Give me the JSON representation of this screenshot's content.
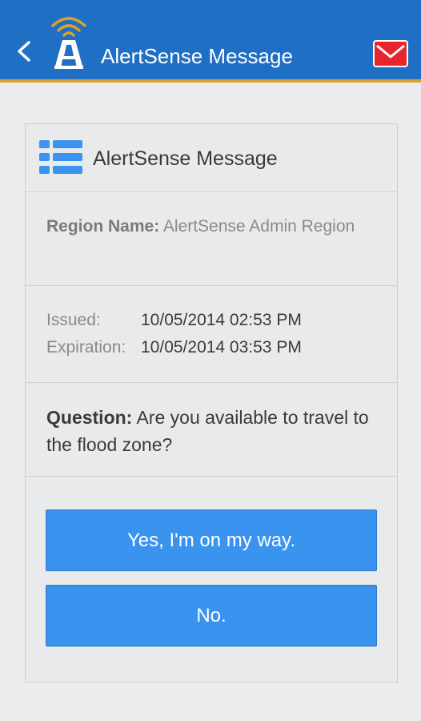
{
  "header": {
    "title": "AlertSense Message",
    "back_icon": "chevron-left-icon",
    "logo_icon": "alertsense-tower-logo",
    "mail_icon": "envelope-icon",
    "bar_color": "#1f6fc4",
    "accent_color": "#d8a12a",
    "mail_color": "#e8252b"
  },
  "card": {
    "title": "AlertSense Message",
    "title_icon": "list-icon",
    "region": {
      "label": "Region Name:",
      "value": "AlertSense Admin Region"
    },
    "dates": {
      "issued_label": "Issued:",
      "issued_value": "10/05/2014 02:53 PM",
      "expiration_label": "Expiration:",
      "expiration_value": "10/05/2014 03:53 PM"
    },
    "question": {
      "label": "Question:",
      "text": "Are you available to travel to the flood zone?"
    },
    "answers": [
      {
        "label": "Yes, I'm on my way."
      },
      {
        "label": "No."
      }
    ],
    "button_color": "#3a93ee"
  }
}
